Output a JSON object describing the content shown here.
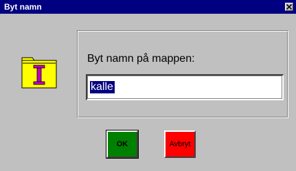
{
  "window": {
    "title": "Byt namn"
  },
  "icons": {
    "close": "close-icon",
    "folder": "folder-icon"
  },
  "form": {
    "prompt": "Byt namn på mappen:",
    "value": "kalle"
  },
  "buttons": {
    "ok_label": "OK",
    "cancel_label": "Avbryt"
  },
  "colors": {
    "titlebar": "#000080",
    "ok_button": "#008000",
    "cancel_button": "#ff0000",
    "folder": "#ffff00",
    "folder_letter": "#c000c0"
  }
}
